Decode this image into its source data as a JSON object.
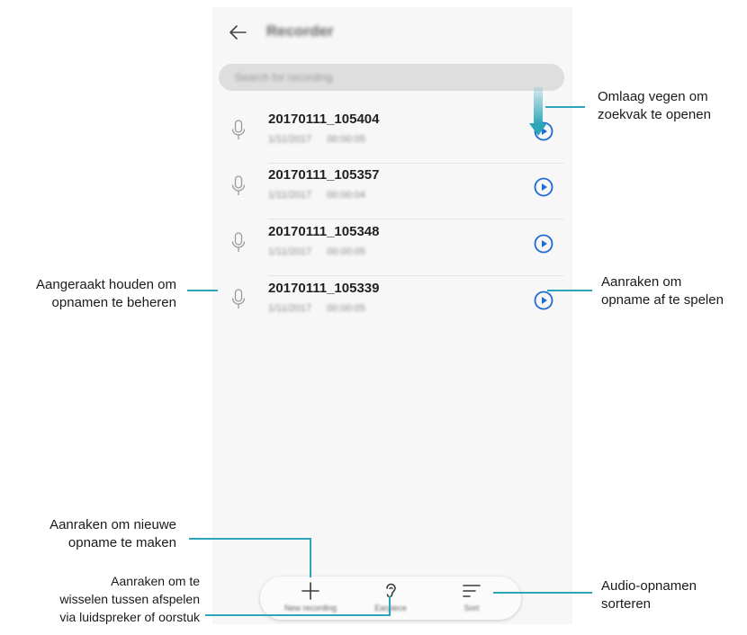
{
  "app": {
    "title": "Recorder",
    "search_placeholder": "Search for recording"
  },
  "recordings": [
    {
      "name": "20170111_105404",
      "date": "1/11/2017",
      "duration": "00:00:05"
    },
    {
      "name": "20170111_105357",
      "date": "1/11/2017",
      "duration": "00:00:04"
    },
    {
      "name": "20170111_105348",
      "date": "1/11/2017",
      "duration": "00:00:05"
    },
    {
      "name": "20170111_105339",
      "date": "1/11/2017",
      "duration": "00:00:05"
    }
  ],
  "bottom_bar": {
    "new_recording": "New recording",
    "earpiece": "Earpiece",
    "sort": "Sort"
  },
  "callouts": {
    "swipe": [
      "Omlaag vegen om",
      "zoekvak te openen"
    ],
    "play": [
      "Aanraken om",
      "opname af te spelen"
    ],
    "manage": [
      "Aangeraakt houden om",
      "opnamen te beheren"
    ],
    "new": [
      "Aanraken om nieuwe",
      "opname te maken"
    ],
    "toggle": [
      "Aanraken om te",
      "wisselen tussen afspelen",
      "via luidspreker of oorstuk"
    ],
    "sort": [
      "Audio-opnamen",
      "sorteren"
    ]
  },
  "colors": {
    "accent": "#2aa6b8",
    "play_icon": "#1e6ad6",
    "leader_line": "#2aa6b8"
  }
}
